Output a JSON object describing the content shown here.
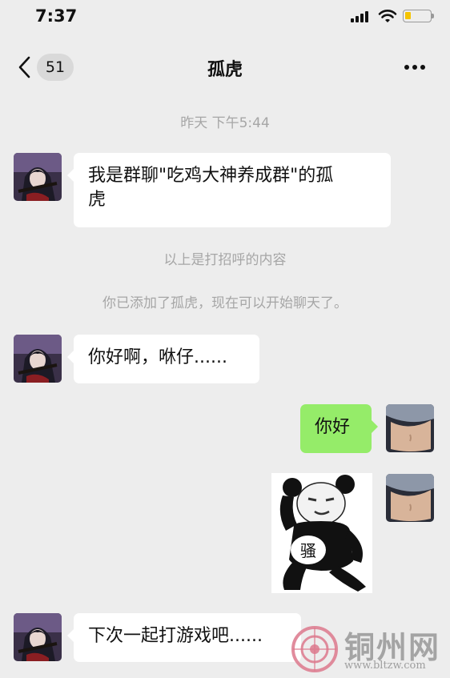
{
  "status_bar": {
    "time": "7:37"
  },
  "nav": {
    "unread_count": "51",
    "title": "孤虎"
  },
  "chat": {
    "timestamp": "昨天 下午5:44",
    "messages": [
      {
        "side": "left",
        "text_line1": "我是群聊\"吃鸡大神养成群\"的孤",
        "text_line2": "虎"
      },
      {
        "side": "left",
        "text": "你好啊，咻仔......"
      },
      {
        "side": "right",
        "text": "你好"
      },
      {
        "side": "right",
        "type": "sticker",
        "sticker_text": "骚"
      },
      {
        "side": "left",
        "text": "下次一起打游戏吧......"
      }
    ],
    "system_greeting": "以上是打招呼的内容",
    "system_added": "你已添加了孤虎，现在可以开始聊天了。"
  },
  "watermark": {
    "name": "铜州网",
    "url": "www.bltzw.com"
  },
  "colors": {
    "background": "#ededed",
    "bubble_self": "#95ec69",
    "bubble_other": "#ffffff",
    "system_text": "#a6a6a6"
  },
  "icons": [
    "back-chevron-icon",
    "signal-icon",
    "wifi-icon",
    "battery-icon",
    "more-dots-icon"
  ]
}
